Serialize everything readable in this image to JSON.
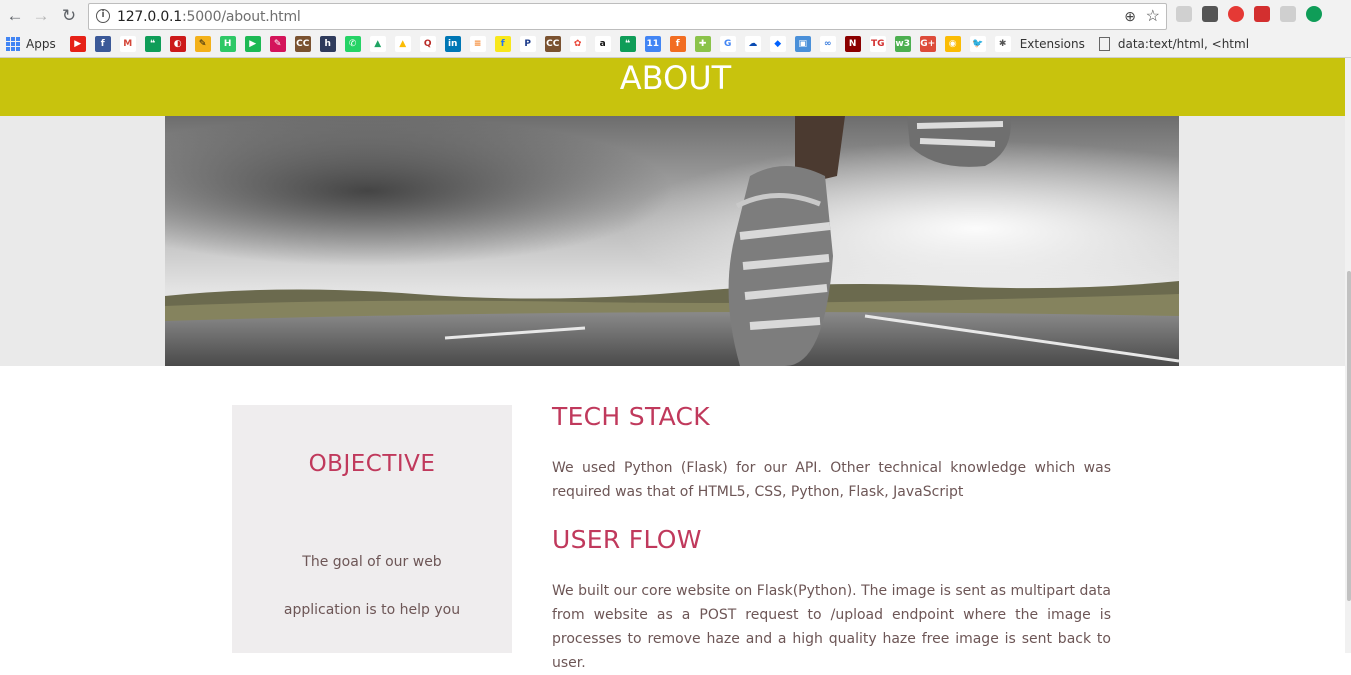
{
  "browser": {
    "url_host": "127.0.0.1",
    "url_path": ":5000/about.html",
    "bookmarks_apps_label": "Apps",
    "bookmarks_extensions_label": "Extensions",
    "bookmarks_data_label": "data:text/html, <html"
  },
  "bookmarks_icons": [
    {
      "name": "youtube-icon",
      "color": "#e62117",
      "glyph": "▶"
    },
    {
      "name": "facebook-icon",
      "color": "#3b5998",
      "glyph": "f"
    },
    {
      "name": "gmail-icon",
      "color": "#ffffff",
      "glyph": "M",
      "fg": "#d44638"
    },
    {
      "name": "hangouts-icon",
      "color": "#0f9d58",
      "glyph": "❝"
    },
    {
      "name": "opera-red-icon",
      "color": "#cc1a1a",
      "glyph": "◐"
    },
    {
      "name": "pencil-icon",
      "color": "#f3b11a",
      "glyph": "✎",
      "fg": "#111"
    },
    {
      "name": "hipchat-icon",
      "color": "#2ec866",
      "glyph": "H"
    },
    {
      "name": "play-icon",
      "color": "#1db954",
      "glyph": "▶"
    },
    {
      "name": "bookmark-pink-icon",
      "color": "#d4145a",
      "glyph": "✎"
    },
    {
      "name": "cc-icon",
      "color": "#7a5230",
      "glyph": "CC"
    },
    {
      "name": "h-icon",
      "color": "#2f3b5c",
      "glyph": "h"
    },
    {
      "name": "whatsapp-icon",
      "color": "#25d366",
      "glyph": "✆"
    },
    {
      "name": "drive-icon",
      "color": "#ffffff",
      "glyph": "▲",
      "fg": "#1fa463"
    },
    {
      "name": "drive2-icon",
      "color": "#ffffff",
      "glyph": "▲",
      "fg": "#fbbc04"
    },
    {
      "name": "quora-icon",
      "color": "#ffffff",
      "glyph": "Q",
      "fg": "#b92b27"
    },
    {
      "name": "linkedin-icon",
      "color": "#0077b5",
      "glyph": "in"
    },
    {
      "name": "stackoverflow-icon",
      "color": "#ffffff",
      "glyph": "≡",
      "fg": "#f48024"
    },
    {
      "name": "flipkart-icon",
      "color": "#f8e71c",
      "glyph": "f",
      "fg": "#2874f0"
    },
    {
      "name": "paytm-icon",
      "color": "#ffffff",
      "glyph": "P",
      "fg": "#1b3a8a"
    },
    {
      "name": "cc2-icon",
      "color": "#7a5230",
      "glyph": "CC"
    },
    {
      "name": "photos-icon",
      "color": "#ffffff",
      "glyph": "✿",
      "fg": "#ea4335"
    },
    {
      "name": "amazon-icon",
      "color": "#ffffff",
      "glyph": "a",
      "fg": "#111"
    },
    {
      "name": "hangouts2-icon",
      "color": "#0f9d58",
      "glyph": "❝"
    },
    {
      "name": "calendar-icon",
      "color": "#4285f4",
      "glyph": "11"
    },
    {
      "name": "fiverr-icon",
      "color": "#f26d21",
      "glyph": "f"
    },
    {
      "name": "sheets-icon",
      "color": "#8bc34a",
      "glyph": "✚"
    },
    {
      "name": "google-icon",
      "color": "#ffffff",
      "glyph": "G",
      "fg": "#4285f4"
    },
    {
      "name": "onedrive-icon",
      "color": "#ffffff",
      "glyph": "☁",
      "fg": "#094ab2"
    },
    {
      "name": "dropbox-icon",
      "color": "#ffffff",
      "glyph": "◆",
      "fg": "#0061fe"
    },
    {
      "name": "photos2-icon",
      "color": "#4a90d9",
      "glyph": "▣"
    },
    {
      "name": "link-icon",
      "color": "#ffffff",
      "glyph": "∞",
      "fg": "#3b7ddd"
    },
    {
      "name": "netflix-icon",
      "color": "#8b0000",
      "glyph": "N"
    },
    {
      "name": "tg-icon",
      "color": "#ffffff",
      "glyph": "TG",
      "fg": "#d32f2f"
    },
    {
      "name": "w3-icon",
      "color": "#4caf50",
      "glyph": "w3"
    },
    {
      "name": "gplus-icon",
      "color": "#dd4b39",
      "glyph": "G+"
    },
    {
      "name": "keep-icon",
      "color": "#fbbc04",
      "glyph": "◉"
    },
    {
      "name": "twitter-icon",
      "color": "#ffffff",
      "glyph": "🐦",
      "fg": "#1da1f2"
    },
    {
      "name": "puzzle-icon",
      "color": "#ffffff",
      "glyph": "✱",
      "fg": "#555"
    }
  ],
  "page": {
    "title": "ABOUT",
    "objective_title": "OBJECTIVE",
    "objective_line1": "The goal of our web",
    "objective_line2": "application is to help you",
    "tech_title": "TECH STACK",
    "tech_text": "We used Python (Flask) for our API. Other technical knowledge which was required was that of HTML5, CSS, Python, Flask, JavaScript",
    "flow_title": "USER FLOW",
    "flow_text": "We built our core website on Flask(Python). The image is sent as multipart data from website as a POST request to /upload endpoint where the image is processes to remove haze and a high quality haze free image is sent back to user."
  },
  "colors": {
    "header_bg": "#c8c30d",
    "accent": "#c0395c",
    "body_text": "#6d5656",
    "card_bg": "#efedee"
  }
}
